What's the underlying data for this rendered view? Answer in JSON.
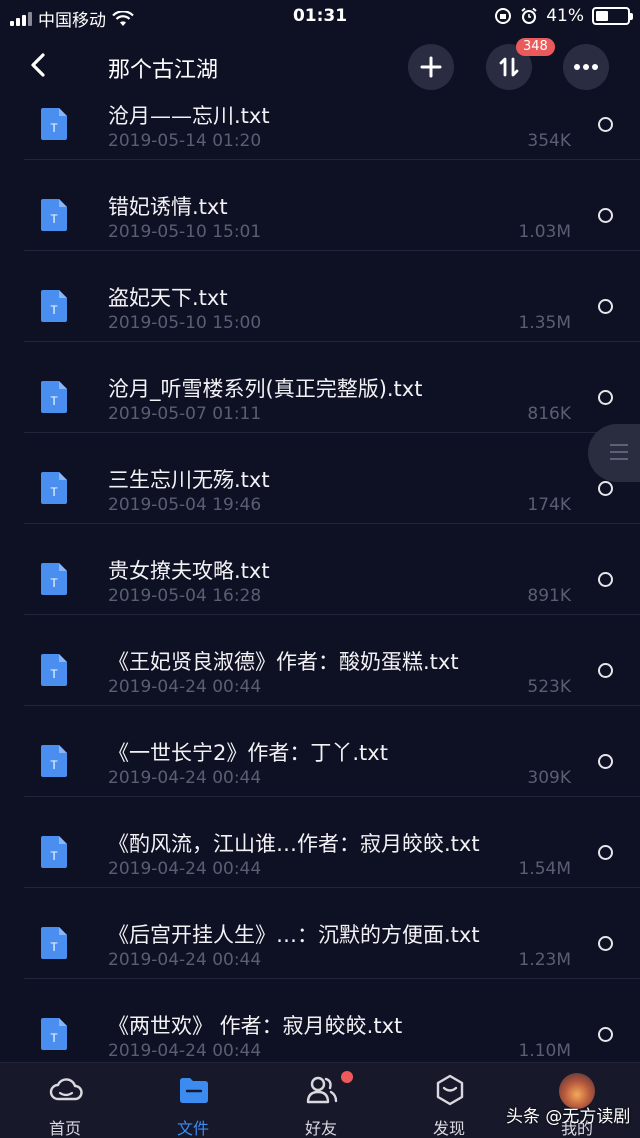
{
  "status": {
    "carrier": "中国移动",
    "time": "01:31",
    "battery": "41%",
    "battery_level": 0.41
  },
  "header": {
    "title": "那个古江湖",
    "badge": "348"
  },
  "files": [
    {
      "name": "沧月——忘川.txt",
      "date": "2019-05-14 01:20",
      "size": "354K"
    },
    {
      "name": "错妃诱情.txt",
      "date": "2019-05-10 15:01",
      "size": "1.03M"
    },
    {
      "name": "盗妃天下.txt",
      "date": "2019-05-10 15:00",
      "size": "1.35M"
    },
    {
      "name": "沧月_听雪楼系列(真正完整版).txt",
      "date": "2019-05-07 01:11",
      "size": "816K"
    },
    {
      "name": "三生忘川无殇.txt",
      "date": "2019-05-04 19:46",
      "size": "174K"
    },
    {
      "name": "贵女撩夫攻略.txt",
      "date": "2019-05-04 16:28",
      "size": "891K"
    },
    {
      "name": "《王妃贤良淑德》作者：酸奶蛋糕.txt",
      "date": "2019-04-24 00:44",
      "size": "523K"
    },
    {
      "name": "《一世长宁2》作者：丁丫.txt",
      "date": "2019-04-24 00:44",
      "size": "309K"
    },
    {
      "name": "《酌风流，江山谁…作者：寂月皎皎.txt",
      "date": "2019-04-24 00:44",
      "size": "1.54M"
    },
    {
      "name": "《后宫开挂人生》…：沉默的方便面.txt",
      "date": "2019-04-24 00:44",
      "size": "1.23M"
    },
    {
      "name": "《两世欢》 作者：寂月皎皎.txt",
      "date": "2019-04-24 00:44",
      "size": "1.10M"
    }
  ],
  "file_icon_letter": "T",
  "tabs": [
    {
      "label": "首页",
      "icon": "cloud-icon"
    },
    {
      "label": "文件",
      "icon": "folder-icon"
    },
    {
      "label": "好友",
      "icon": "friends-icon"
    },
    {
      "label": "发现",
      "icon": "discover-icon"
    },
    {
      "label": "我的",
      "icon": "avatar"
    }
  ],
  "watermark": "头条 @无方读剧",
  "colors": {
    "background": "#0e1023",
    "accent": "#3b8bf0",
    "badge": "#ea5a5a",
    "file_icon": "#4a8ef0"
  }
}
